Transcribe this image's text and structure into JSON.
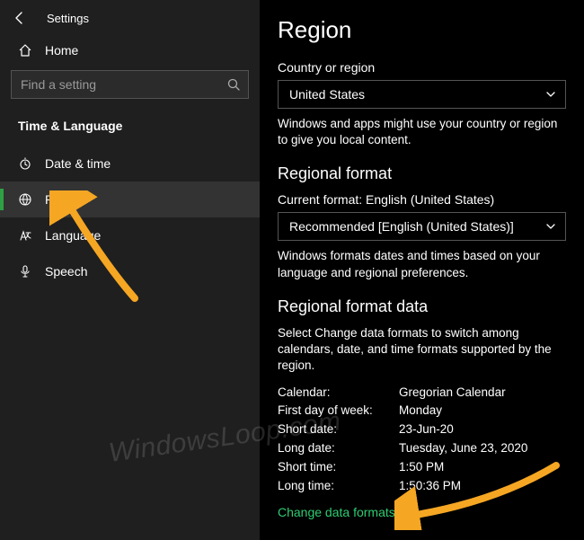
{
  "app_title": "Settings",
  "home_label": "Home",
  "search_placeholder": "Find a setting",
  "sidebar_heading": "Time & Language",
  "nav": [
    {
      "label": "Date & time"
    },
    {
      "label": "Region"
    },
    {
      "label": "Language"
    },
    {
      "label": "Speech"
    }
  ],
  "main": {
    "title": "Region",
    "country_label": "Country or region",
    "country_value": "United States",
    "country_desc": "Windows and apps might use your country or region to give you local content.",
    "regfmt_title": "Regional format",
    "regfmt_current": "Current format: English (United States)",
    "regfmt_value": "Recommended [English (United States)]",
    "regfmt_desc": "Windows formats dates and times based on your language and regional preferences.",
    "regdata_title": "Regional format data",
    "regdata_desc": "Select Change data formats to switch among calendars, date, and time formats supported by the region.",
    "kv": [
      {
        "k": "Calendar:",
        "v": "Gregorian Calendar"
      },
      {
        "k": "First day of week:",
        "v": "Monday"
      },
      {
        "k": "Short date:",
        "v": "23-Jun-20"
      },
      {
        "k": "Long date:",
        "v": "Tuesday, June 23, 2020"
      },
      {
        "k": "Short time:",
        "v": "1:50 PM"
      },
      {
        "k": "Long time:",
        "v": "1:50:36 PM"
      }
    ],
    "change_link": "Change data formats"
  },
  "watermark": "WindowsLoop.com"
}
